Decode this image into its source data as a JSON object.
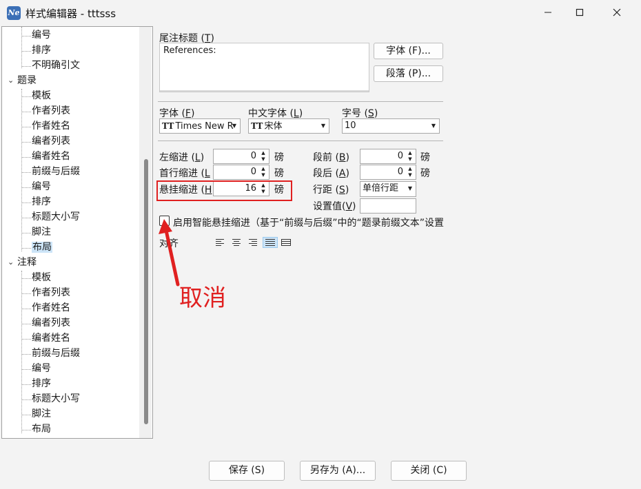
{
  "window": {
    "title": "样式编辑器 - tttsss",
    "app_icon_text": "Ne",
    "minimize_label": "—",
    "maximize_label": "☐",
    "close_label": "✕"
  },
  "tree": {
    "items": [
      {
        "label": "编号",
        "level": 1
      },
      {
        "label": "排序",
        "level": 1
      },
      {
        "label": "不明确引文",
        "level": 1
      },
      {
        "label": "题录",
        "level": 0,
        "expanded": true
      },
      {
        "label": "模板",
        "level": 1
      },
      {
        "label": "作者列表",
        "level": 1
      },
      {
        "label": "作者姓名",
        "level": 1
      },
      {
        "label": "编者列表",
        "level": 1
      },
      {
        "label": "编者姓名",
        "level": 1
      },
      {
        "label": "前缀与后缀",
        "level": 1
      },
      {
        "label": "编号",
        "level": 1
      },
      {
        "label": "排序",
        "level": 1
      },
      {
        "label": "标题大小写",
        "level": 1
      },
      {
        "label": "脚注",
        "level": 1
      },
      {
        "label": "布局",
        "level": 1,
        "selected": true
      },
      {
        "label": "注释",
        "level": 0,
        "expanded": true
      },
      {
        "label": "模板",
        "level": 1
      },
      {
        "label": "作者列表",
        "level": 1
      },
      {
        "label": "作者姓名",
        "level": 1
      },
      {
        "label": "编者列表",
        "level": 1
      },
      {
        "label": "编者姓名",
        "level": 1
      },
      {
        "label": "前缀与后缀",
        "level": 1
      },
      {
        "label": "编号",
        "level": 1
      },
      {
        "label": "排序",
        "level": 1
      },
      {
        "label": "标题大小写",
        "level": 1
      },
      {
        "label": "脚注",
        "level": 1
      },
      {
        "label": "布局",
        "level": 1
      }
    ]
  },
  "endnote_title": {
    "label": "尾注标题",
    "hotkey": "T",
    "value": "References:",
    "font_button": "字体 (F)...",
    "paragraph_button": "段落 (P)..."
  },
  "font": {
    "font_label": "字体",
    "font_hotkey": "F",
    "font_value": "Times New R",
    "cn_font_label": "中文字体",
    "cn_font_hotkey": "L",
    "cn_font_value": "宋体",
    "size_label": "字号",
    "size_hotkey": "S",
    "size_value": "10"
  },
  "indent": {
    "left_label": "左缩进",
    "left_hotkey": "L",
    "left_value": "0",
    "first_label": "首行缩进",
    "first_hotkey": "L",
    "first_value": "0",
    "hanging_label": "悬挂缩进",
    "hanging_hotkey": "H",
    "hanging_value": "16",
    "unit": "磅"
  },
  "spacing": {
    "before_label": "段前",
    "before_hotkey": "B",
    "before_value": "0",
    "after_label": "段后",
    "after_hotkey": "A",
    "after_value": "0",
    "line_label": "行距",
    "line_hotkey": "S",
    "line_value": "单倍行距",
    "set_label": "设置值",
    "set_hotkey": "V",
    "set_value": "",
    "unit": "磅"
  },
  "smart_hanging": {
    "checked": false,
    "label": "启用智能悬挂缩进（基于“前缀与后缀”中的“题录前缀文本”设置"
  },
  "alignment": {
    "label": "对齐",
    "options": [
      "left",
      "center",
      "right",
      "justify",
      "distributed"
    ],
    "selected": "justify"
  },
  "annotation": {
    "text": "取消",
    "color": "#e02020"
  },
  "footer": {
    "save_label": "保存 (S)",
    "save_as_label": "另存为 (A)...",
    "close_label": "关闭 (C)"
  }
}
